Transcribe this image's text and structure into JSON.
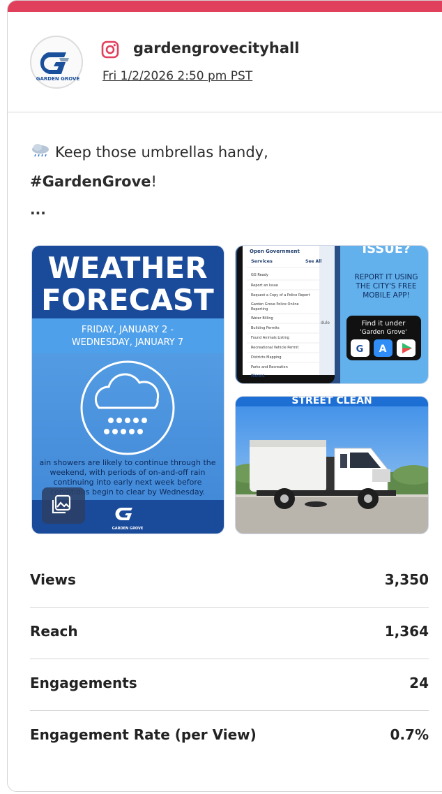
{
  "post": {
    "account": "gardengrovecityhall",
    "timestamp": "Fri 1/2/2026 2:50 pm PST",
    "logo_text": "GARDEN GROVE",
    "text_line1": "Keep those umbrellas handy,",
    "hashtag": "#GardenGrove",
    "text_after_hashtag": "!",
    "more": "...",
    "colors": {
      "accent": "#e0405c",
      "weather_blue": "#1a4a9a",
      "sky_blue": "#5aa0e0"
    }
  },
  "weather_image": {
    "title1": "WEATHER",
    "title2": "FORECAST",
    "dates1": "FRIDAY, JANUARY 2 -",
    "dates2": "WEDNESDAY, JANUARY 7",
    "desc1": "ain showers are likely to continue through the",
    "desc2": "weekend, with periods of on-and-off rain",
    "desc3": "continuing into early next week before",
    "desc4": "conditions begin to clear by Wednesday.",
    "footer_logo": "GARDEN GROVE"
  },
  "app_image": {
    "menu_title": "Open Government",
    "services": "Services",
    "see_all": "See All",
    "items": [
      "GG Ready",
      "Report an Issue",
      "Request a Copy of a Police Report",
      "Garden Grove Police Online",
      "Reporting",
      "Water Billing",
      "Building Permits",
      "Found Animals Listing",
      "Recreational Vehicle Permit",
      "Districts Mapping",
      "Parks and Recreation"
    ],
    "news": "News",
    "side_text": "dule",
    "headline": "ISSUE?",
    "promo1": "REPORT IT USING",
    "promo2": "THE CITY'S FREE",
    "promo3": "MOBILE APP!",
    "find1": "Find it under",
    "find2": "'Garden Grove'"
  },
  "sweeper_image": {
    "banner": "STREET CLEAN"
  },
  "stats": [
    {
      "label": "Views",
      "value": "3,350"
    },
    {
      "label": "Reach",
      "value": "1,364"
    },
    {
      "label": "Engagements",
      "value": "24"
    },
    {
      "label": "Engagement Rate (per View)",
      "value": "0.7%"
    }
  ]
}
